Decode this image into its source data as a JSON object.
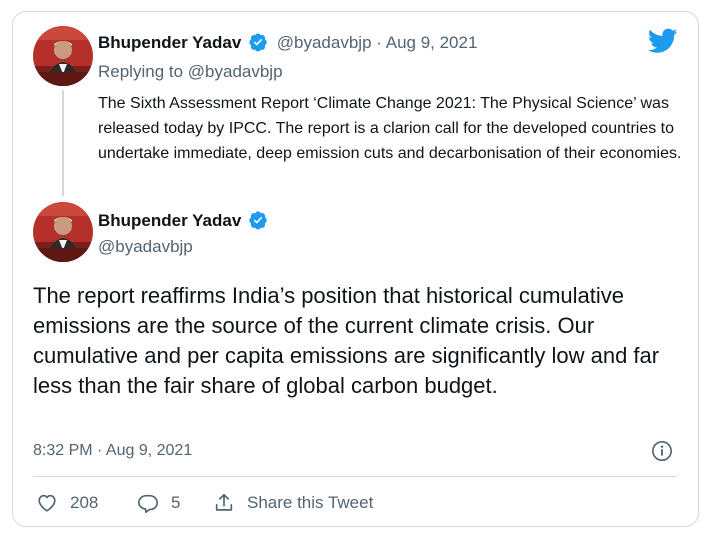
{
  "parent_tweet": {
    "author_name": "Bhupender Yadav",
    "handle": "@byadavbjp",
    "separator": "·",
    "date": "Aug 9, 2021",
    "replying_to": "Replying to @byadavbjp",
    "text": "The Sixth Assessment Report ‘Climate Change 2021: The Physical Science’ was released today by IPCC. The report is a clarion call for the developed countries to undertake immediate, deep emission cuts and decarbonisation of their economies."
  },
  "main_tweet": {
    "author_name": "Bhupender Yadav",
    "handle": "@byadavbjp",
    "text": "The report reaffirms India’s position that historical cumulative emissions are the source of the current climate crisis. Our cumulative and per capita emissions are significantly low and far less than the fair share of global carbon budget.",
    "timestamp": "8:32 PM · Aug 9, 2021"
  },
  "actions": {
    "like_count": "208",
    "reply_count": "5",
    "share_label": "Share this Tweet"
  },
  "colors": {
    "twitter_blue": "#1d9bf0",
    "muted_text": "#536471",
    "border": "#cfd9de"
  },
  "icons": [
    "twitter-logo-icon",
    "verified-badge-icon",
    "info-icon",
    "heart-icon",
    "reply-icon",
    "share-icon"
  ]
}
